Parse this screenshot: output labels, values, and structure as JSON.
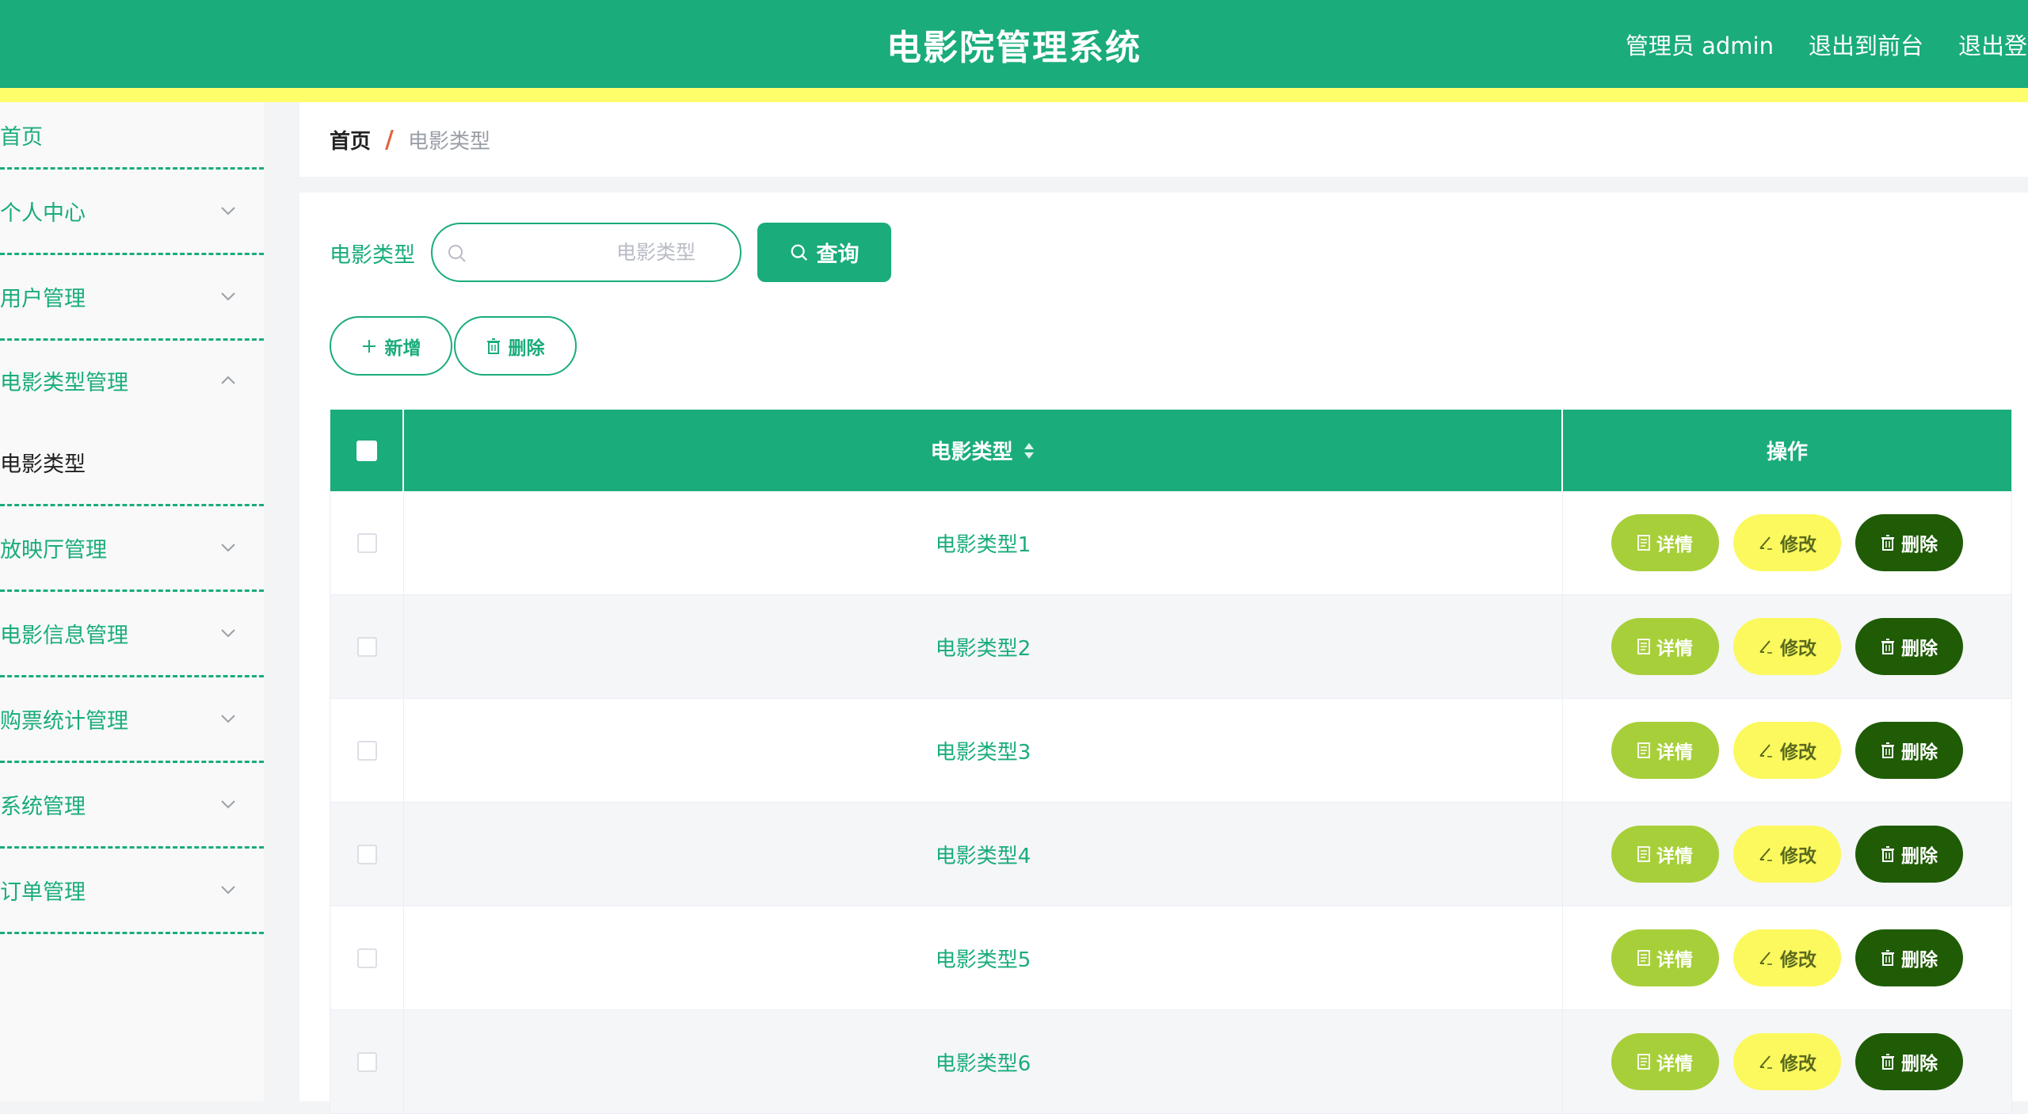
{
  "header": {
    "title": "电影院管理系统",
    "admin_label": "管理员 admin",
    "front_link": "退出到前台",
    "logout_link": "退出登录"
  },
  "colors": {
    "primary": "#1aac7b",
    "stripe": "#fefd6a",
    "detail_button": "#a7cf3a",
    "edit_button": "#fbf95e",
    "delete_button": "#1f5c05"
  },
  "sidebar": {
    "items": [
      {
        "label": "首页"
      },
      {
        "label": "个人中心"
      },
      {
        "label": "用户管理"
      },
      {
        "label": "电影类型管理"
      },
      {
        "label": "放映厅管理"
      },
      {
        "label": "电影信息管理"
      },
      {
        "label": "购票统计管理"
      },
      {
        "label": "系统管理"
      },
      {
        "label": "订单管理"
      }
    ],
    "sub_item": {
      "label": "电影类型"
    }
  },
  "breadcrumb": {
    "home": "首页",
    "separator": "/",
    "current": "电影类型"
  },
  "search": {
    "label": "电影类型",
    "placeholder": "电影类型",
    "query_button": "查询"
  },
  "actions": {
    "add_button": "新增",
    "delete_button": "删除"
  },
  "table": {
    "columns": [
      "电影类型",
      "操作"
    ],
    "rows": [
      {
        "type": "电影类型1"
      },
      {
        "type": "电影类型2"
      },
      {
        "type": "电影类型3"
      },
      {
        "type": "电影类型4"
      },
      {
        "type": "电影类型5"
      },
      {
        "type": "电影类型6"
      }
    ],
    "row_actions": {
      "detail": "详情",
      "edit": "修改",
      "delete": "删除"
    }
  }
}
